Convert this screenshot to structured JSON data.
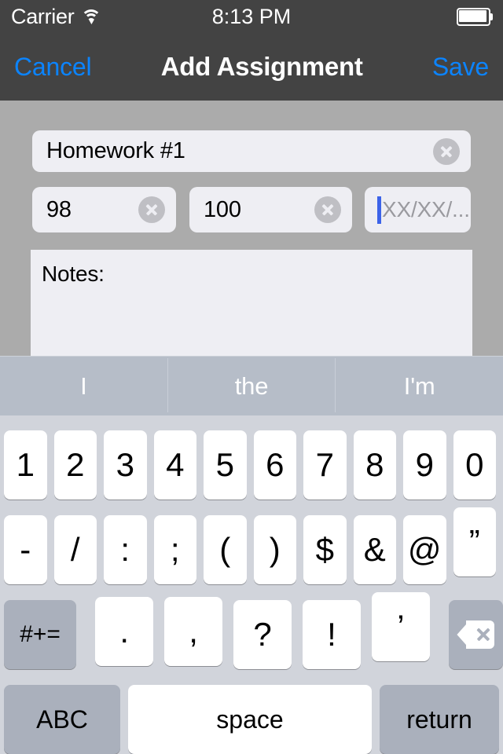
{
  "status_bar": {
    "carrier": "Carrier",
    "time": "8:13 PM",
    "wifi_icon": "wifi-icon",
    "battery_icon": "battery-icon"
  },
  "nav_bar": {
    "cancel_label": "Cancel",
    "title": "Add Assignment",
    "save_label": "Save",
    "accent_color": "#0b84ff",
    "background_color": "#434343"
  },
  "form": {
    "title_field": {
      "value": "Homework #1",
      "has_clear": true
    },
    "score_field": {
      "value": "98",
      "has_clear": true
    },
    "total_field": {
      "value": "100",
      "has_clear": true
    },
    "date_field": {
      "value": "",
      "placeholder": "XX/XX/...",
      "focused": true,
      "has_clear": false
    },
    "notes": {
      "label": "Notes:",
      "value": ""
    },
    "background_color": "#ababab",
    "field_color": "#eeeef3",
    "caret_color": "#3c63e8"
  },
  "keyboard": {
    "predictions": [
      "I",
      "the",
      "I'm"
    ],
    "row1": [
      "1",
      "2",
      "3",
      "4",
      "5",
      "6",
      "7",
      "8",
      "9",
      "0"
    ],
    "row2": [
      "-",
      "/",
      ":",
      ";",
      "(",
      ")",
      "$",
      "&",
      "@",
      "”"
    ],
    "row3": [
      ".",
      ",",
      "?",
      "!",
      "’"
    ],
    "symbols_key": "#+=",
    "backspace_icon": "backspace-icon",
    "abc_key": "ABC",
    "space_key": "space",
    "return_key": "return",
    "background_color": "#d1d4db",
    "key_color": "#ffffff",
    "dark_key_color": "#aab0bc",
    "predict_bar_color": "#b6bdc8"
  }
}
